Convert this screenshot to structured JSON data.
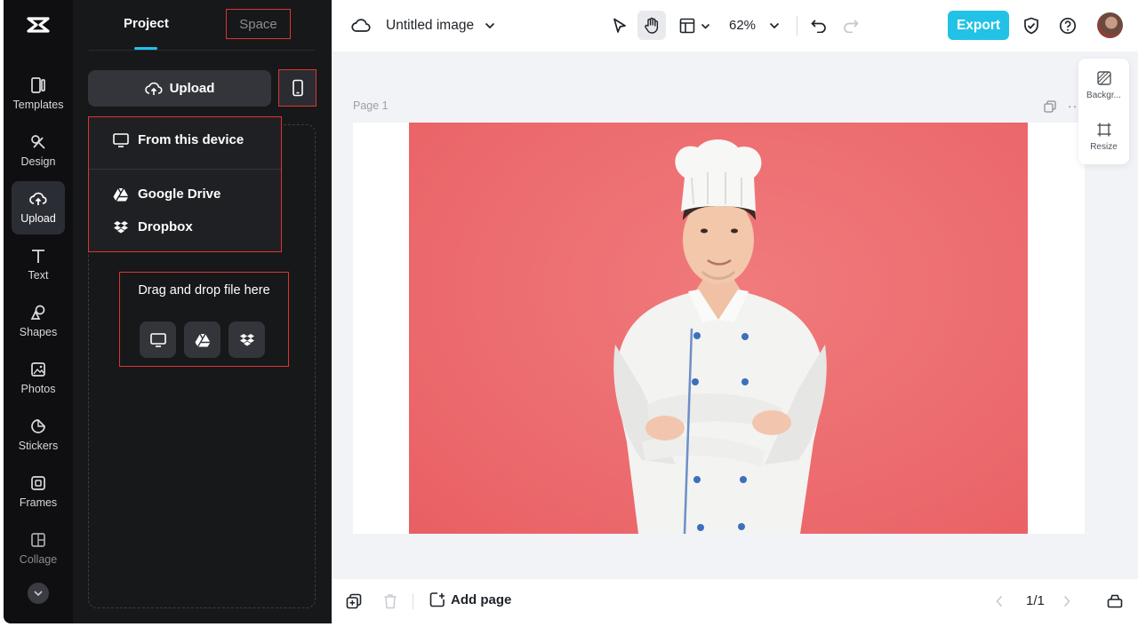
{
  "rail": {
    "items": [
      {
        "label": "Templates",
        "icon": "templates-icon"
      },
      {
        "label": "Design",
        "icon": "design-icon"
      },
      {
        "label": "Upload",
        "icon": "upload-cloud-icon",
        "active": true
      },
      {
        "label": "Text",
        "icon": "text-icon"
      },
      {
        "label": "Shapes",
        "icon": "shapes-icon"
      },
      {
        "label": "Photos",
        "icon": "photos-icon"
      },
      {
        "label": "Stickers",
        "icon": "stickers-icon"
      },
      {
        "label": "Frames",
        "icon": "frames-icon"
      },
      {
        "label": "Collage",
        "icon": "collage-icon"
      }
    ]
  },
  "panel": {
    "tabs": {
      "project": "Project",
      "space": "Space"
    },
    "upload_label": "Upload",
    "menu": {
      "from_device": "From this device",
      "google_drive": "Google Drive",
      "dropbox": "Dropbox"
    },
    "dropzone_text": "Drag and drop file here"
  },
  "topbar": {
    "title": "Untitled image",
    "zoom": "62%",
    "export_label": "Export"
  },
  "canvas": {
    "page_label": "Page 1",
    "side_tools": {
      "background": "Backgr...",
      "resize": "Resize"
    }
  },
  "bottombar": {
    "add_page": "Add page",
    "pager": "1/1"
  },
  "colors": {
    "accent": "#22c2e6",
    "photo_background": "#ec6b6e"
  }
}
